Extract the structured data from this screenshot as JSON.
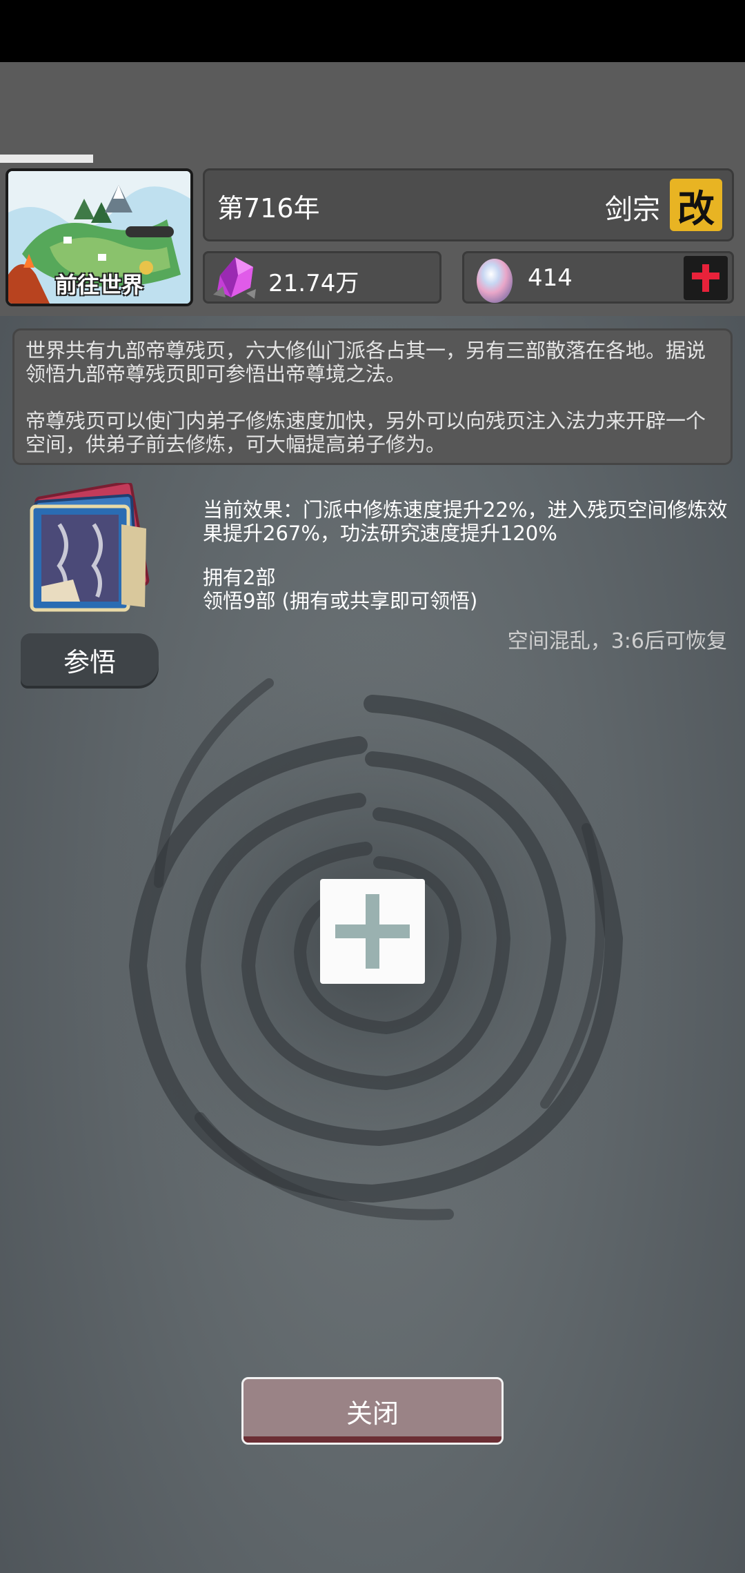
{
  "header": {
    "progress_fraction": 0.125,
    "world_button_label": "前往世界",
    "year": "第716年",
    "sect_name": "剑宗",
    "rename_label": "改",
    "resources": {
      "spirit_stone": "21.74万",
      "egg": "414"
    }
  },
  "description": {
    "para1": "世界共有九部帝尊残页，六大修仙门派各占其一，另有三部散落在各地。据说领悟九部帝尊残页即可参悟出帝尊境之法。",
    "para2": "帝尊残页可以使门内弟子修炼速度加快，另外可以向残页注入法力来开辟一个空间，供弟子前去修炼，可大幅提高弟子修为。"
  },
  "status": {
    "effect": "当前效果：门派中修炼速度提升22%，进入残页空间修炼效果提升267%，功法研究速度提升120%",
    "own": "拥有2部",
    "comprehend": "领悟9部 (拥有或共享即可领悟)",
    "recover": "空间混乱，3:6后可恢复"
  },
  "buttons": {
    "comprehend_label": "参悟",
    "close_label": "关闭"
  },
  "icons": {
    "world": "world-map-icon",
    "spirit_stone": "purple-crystal-icon",
    "egg": "spirit-egg-icon",
    "add": "red-plus-icon",
    "book": "scripture-books-icon",
    "open_space": "plus-icon"
  },
  "colors": {
    "rename_bg": "#e8b423",
    "add_plus": "#e8223a",
    "close_bg": "#9a8386"
  }
}
